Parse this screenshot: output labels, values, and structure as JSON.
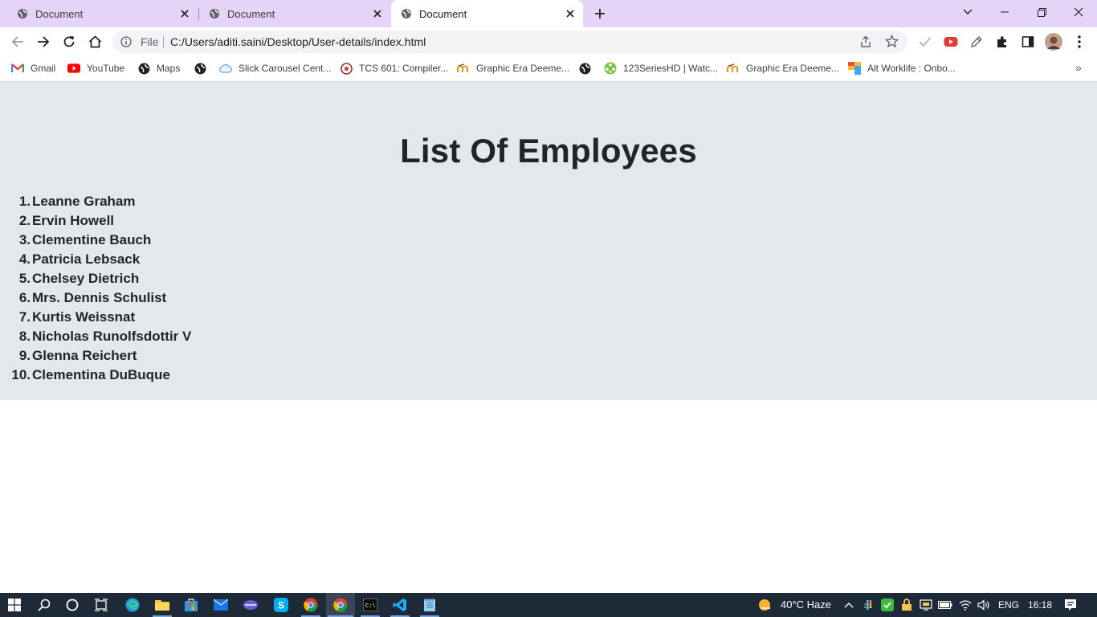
{
  "browser": {
    "tabs": [
      {
        "title": "Document",
        "active": false
      },
      {
        "title": "Document",
        "active": false
      },
      {
        "title": "Document",
        "active": true
      }
    ],
    "address": {
      "scheme_label": "File",
      "url": "C:/Users/aditi.saini/Desktop/User-details/index.html"
    },
    "bookmarks": [
      {
        "label": "Gmail",
        "icon": "gmail-icon"
      },
      {
        "label": "YouTube",
        "icon": "youtube-icon"
      },
      {
        "label": "Maps",
        "icon": "globe-icon"
      },
      {
        "label": "",
        "icon": "globe-icon"
      },
      {
        "label": "Slick Carousel Cent...",
        "icon": "cloud-icon"
      },
      {
        "label": "TCS 601: Compiler...",
        "icon": "course-icon"
      },
      {
        "label": "Graphic Era Deeme...",
        "icon": "moodle-icon"
      },
      {
        "label": "",
        "icon": "globe-icon"
      },
      {
        "label": "123SeriesHD | Watc...",
        "icon": "film-icon"
      },
      {
        "label": "Graphic Era Deeme...",
        "icon": "moodle-icon"
      },
      {
        "label": "Alt Worklife : Onbo...",
        "icon": "altworklife-icon"
      }
    ]
  },
  "page": {
    "heading": "List Of Employees",
    "employees": [
      "Leanne Graham",
      "Ervin Howell",
      "Clementine Bauch",
      "Patricia Lebsack",
      "Chelsey Dietrich",
      "Mrs. Dennis Schulist",
      "Kurtis Weissnat",
      "Nicholas Runolfsdottir V",
      "Glenna Reichert",
      "Clementina DuBuque"
    ]
  },
  "taskbar": {
    "weather": "40°C  Haze",
    "language": "ENG",
    "time": "16:18"
  },
  "colors": {
    "tabstrip": "#e6d3f8",
    "content_panel": "#e5e8eb",
    "taskbar": "#1f2a38"
  }
}
